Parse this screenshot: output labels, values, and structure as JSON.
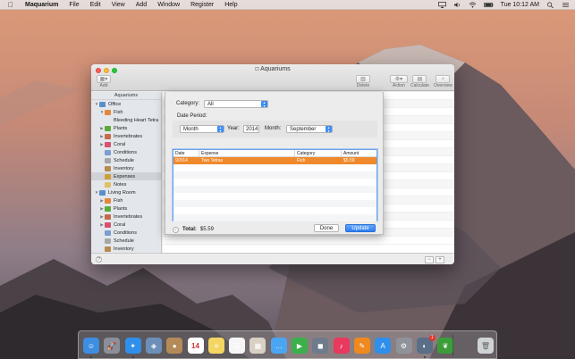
{
  "menubar": {
    "app_name": "Maquarium",
    "items": [
      "File",
      "Edit",
      "View",
      "Add",
      "Window",
      "Register",
      "Help"
    ],
    "clock": "Tue 10:12 AM"
  },
  "window": {
    "title": "Aquariums",
    "toolbar": {
      "add_label": "Add",
      "delete_label": "Delete",
      "action_label": "Action",
      "calculate_label": "Calculate",
      "overview_label": "Overview"
    }
  },
  "sidebar": {
    "header": "Aquariums",
    "items": [
      {
        "label": "Office",
        "level": 0,
        "disclosure": "▼",
        "icon": "tank-icon",
        "color": "#5a8fc7"
      },
      {
        "label": "Fish",
        "level": 1,
        "disclosure": "▼",
        "icon": "fish-icon",
        "color": "#e2873a"
      },
      {
        "label": "Bleeding Heart Tetra",
        "level": 2,
        "disclosure": "",
        "icon": "",
        "color": ""
      },
      {
        "label": "Plants",
        "level": 1,
        "disclosure": "▶",
        "icon": "plant-icon",
        "color": "#5daa3c"
      },
      {
        "label": "Invertebrates",
        "level": 1,
        "disclosure": "▶",
        "icon": "shrimp-icon",
        "color": "#c66a4a"
      },
      {
        "label": "Coral",
        "level": 1,
        "disclosure": "▶",
        "icon": "coral-icon",
        "color": "#d94f6e"
      },
      {
        "label": "Conditions",
        "level": 1,
        "disclosure": "",
        "icon": "flask-icon",
        "color": "#7b9ed1"
      },
      {
        "label": "Schedule",
        "level": 1,
        "disclosure": "",
        "icon": "calendar-icon",
        "color": "#a7a7a7"
      },
      {
        "label": "Inventory",
        "level": 1,
        "disclosure": "",
        "icon": "box-icon",
        "color": "#b78a4e"
      },
      {
        "label": "Expenses",
        "level": 1,
        "disclosure": "",
        "icon": "money-icon",
        "color": "#cf9d39",
        "selected": true
      },
      {
        "label": "Notes",
        "level": 1,
        "disclosure": "",
        "icon": "notes-icon",
        "color": "#e0c065"
      },
      {
        "label": "Living Room",
        "level": 0,
        "disclosure": "▼",
        "icon": "tank-icon",
        "color": "#5a8fc7"
      },
      {
        "label": "Fish",
        "level": 1,
        "disclosure": "▶",
        "icon": "fish-icon",
        "color": "#e2873a"
      },
      {
        "label": "Plants",
        "level": 1,
        "disclosure": "▶",
        "icon": "plant-icon",
        "color": "#5daa3c"
      },
      {
        "label": "Invertebrates",
        "level": 1,
        "disclosure": "▶",
        "icon": "shrimp-icon",
        "color": "#c66a4a"
      },
      {
        "label": "Coral",
        "level": 1,
        "disclosure": "▶",
        "icon": "coral-icon",
        "color": "#d94f6e"
      },
      {
        "label": "Conditions",
        "level": 1,
        "disclosure": "",
        "icon": "flask-icon",
        "color": "#7b9ed1"
      },
      {
        "label": "Schedule",
        "level": 1,
        "disclosure": "",
        "icon": "calendar-icon",
        "color": "#a7a7a7"
      },
      {
        "label": "Inventory",
        "level": 1,
        "disclosure": "",
        "icon": "box-icon",
        "color": "#b78a4e"
      }
    ]
  },
  "sheet": {
    "category_label": "Category:",
    "category_value": "All",
    "period_label": "Date Period:",
    "period_value": "Month",
    "year_label": "Year:",
    "year_value": "2014",
    "month_label": "Month:",
    "month_value": "September",
    "columns": [
      "Date",
      "Expense",
      "Category",
      "Amount"
    ],
    "rows": [
      {
        "date": "9/3/14",
        "expense": "Two Tetras",
        "category": "Fish",
        "amount": "$5.59"
      }
    ],
    "total_label": "Total:",
    "total_value": "$5.59",
    "done_label": "Done",
    "update_label": "Update",
    "selection_color": "#f0892b"
  },
  "footer": {
    "help": "?",
    "minus": "−",
    "plus": "+"
  },
  "dock": {
    "apps": [
      {
        "name": "finder-icon",
        "color": "#3d8de0",
        "glyph": "☺"
      },
      {
        "name": "launchpad-icon",
        "color": "#8a8f99",
        "glyph": "🚀"
      },
      {
        "name": "safari-icon",
        "color": "#2f8fea",
        "glyph": "✦"
      },
      {
        "name": "preview-icon",
        "color": "#6b8fb8",
        "glyph": "◈"
      },
      {
        "name": "contacts-icon",
        "color": "#b48a58",
        "glyph": "●"
      },
      {
        "name": "calendar-icon",
        "color": "#ffffff",
        "glyph": "14"
      },
      {
        "name": "notes-icon",
        "color": "#f3d663",
        "glyph": "≡"
      },
      {
        "name": "reminders-icon",
        "color": "#f6f6f6",
        "glyph": "☰"
      },
      {
        "name": "photos-icon",
        "color": "#d8d0c4",
        "glyph": "▦"
      },
      {
        "name": "messages-icon",
        "color": "#4aa6f2",
        "glyph": "…"
      },
      {
        "name": "facetime-icon",
        "color": "#3bb04a",
        "glyph": "▶"
      },
      {
        "name": "photo-booth-icon",
        "color": "#6e7b8c",
        "glyph": "◼"
      },
      {
        "name": "itunes-icon",
        "color": "#e8395e",
        "glyph": "♪"
      },
      {
        "name": "ibooks-icon",
        "color": "#f0891f",
        "glyph": "✎"
      },
      {
        "name": "app-store-icon",
        "color": "#2f8fea",
        "glyph": "A"
      },
      {
        "name": "system-preferences-icon",
        "color": "#8f9399",
        "glyph": "⚙"
      },
      {
        "name": "maquarium-icon",
        "color": "#5b6e88",
        "glyph": "◐"
      },
      {
        "name": "leaf-icon",
        "color": "#3c9c3a",
        "glyph": "❦"
      },
      {
        "name": "trash-icon",
        "color": "#cfd3d6",
        "glyph": "🗑"
      }
    ],
    "badge_value": "1"
  }
}
